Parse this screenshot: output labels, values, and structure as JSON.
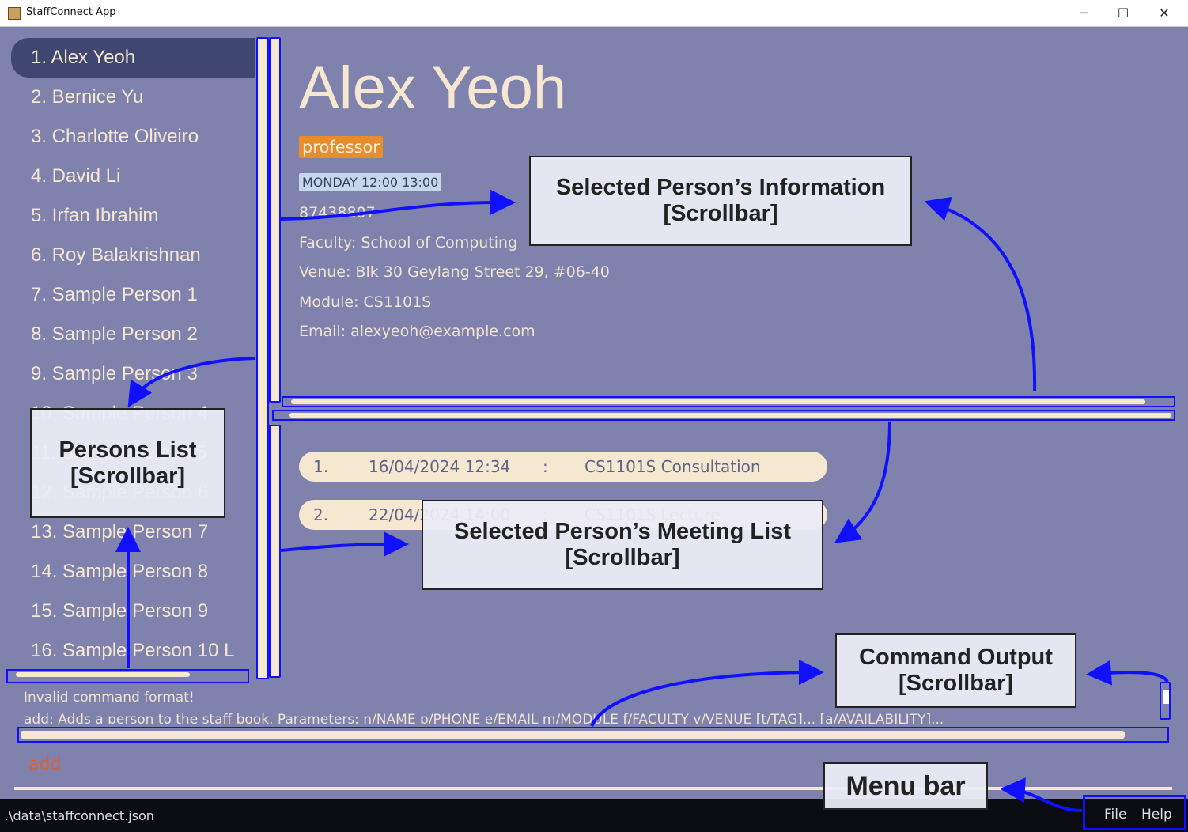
{
  "window": {
    "title": "StaffConnect App",
    "minimize": "─",
    "maximize": "☐",
    "close": "✕"
  },
  "persons": [
    "1.  Alex Yeoh",
    "2.  Bernice Yu",
    "3.  Charlotte Oliveiro",
    "4.  David Li",
    "5.  Irfan Ibrahim",
    "6.  Roy Balakrishnan",
    "7.  Sample Person 1",
    "8.  Sample Person 2",
    "9.  Sample Person 3",
    "10.  Sample Person 4",
    "11.  Sample Person 5",
    "12.  Sample Person 6",
    "13.  Sample Person 7",
    "14.  Sample Person 8",
    "15.  Sample Person 9",
    "16.  Sample Person 10 L"
  ],
  "selected_index": 0,
  "detail": {
    "name": "Alex Yeoh",
    "tag": "professor",
    "availability": "MONDAY 12:00 13:00",
    "phone": "87438807",
    "faculty": "Faculty:  School of Computing",
    "venue": "Venue:  Blk 30 Geylang Street 29, #06-40",
    "module": "Module:  CS1101S",
    "email": "Email:  alexyeoh@example.com"
  },
  "meetings": [
    {
      "index": "1.",
      "datetime": "16/04/2024 12:34",
      "sep": ":",
      "desc": "CS1101S Consultation"
    },
    {
      "index": "2.",
      "datetime": "22/04/2024 14:00",
      "sep": ":",
      "desc": "CS1101S Lecture"
    }
  ],
  "result": {
    "line1": "Invalid command format!",
    "line2": "add: Adds a person to the staff book. Parameters: n/NAME p/PHONE e/EMAIL m/MODULE f/FACULTY v/VENUE [t/TAG]... [a/AVAILABILITY]..."
  },
  "command": {
    "value": "add"
  },
  "status": {
    "path": ".\\data\\staffconnect.json"
  },
  "menu": {
    "file": "File",
    "help": "Help"
  },
  "annotations": {
    "info": [
      "Selected Person’s Information",
      "[Scrollbar]"
    ],
    "meetings": [
      "Selected Person’s Meeting List",
      "[Scrollbar]"
    ],
    "persons": [
      "Persons List",
      "[Scrollbar]"
    ],
    "output": [
      "Command Output",
      "[Scrollbar]"
    ],
    "menubar": "Menu bar"
  },
  "colors": {
    "background": "#7e82ad",
    "selected": "#3f4771",
    "cream": "#f6e7d1",
    "tag": "#e98c2a",
    "annotation": "#1010ff"
  }
}
